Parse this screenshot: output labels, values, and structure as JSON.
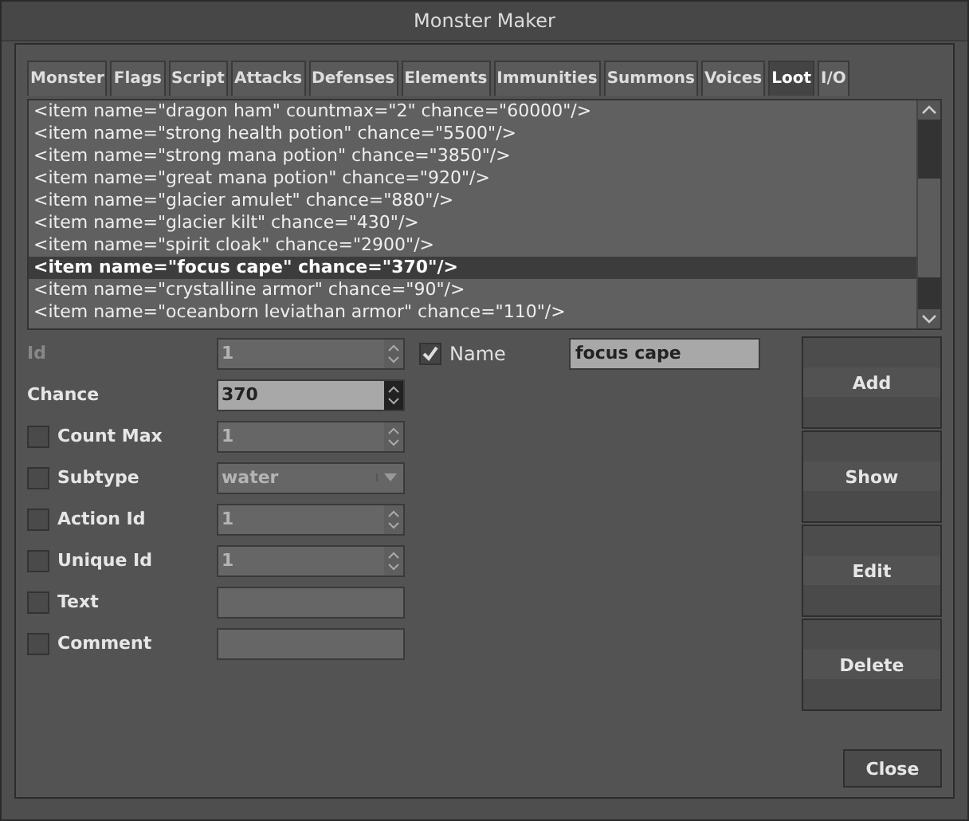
{
  "window": {
    "title": "Monster Maker"
  },
  "tabs": [
    {
      "label": "Monster",
      "selected": false
    },
    {
      "label": "Flags",
      "selected": false
    },
    {
      "label": "Script",
      "selected": false
    },
    {
      "label": "Attacks",
      "selected": false
    },
    {
      "label": "Defenses",
      "selected": false
    },
    {
      "label": "Elements",
      "selected": false
    },
    {
      "label": "Immunities",
      "selected": false
    },
    {
      "label": "Summons",
      "selected": false
    },
    {
      "label": "Voices",
      "selected": false
    },
    {
      "label": "Loot",
      "selected": true
    },
    {
      "label": "I/O",
      "selected": false
    }
  ],
  "loot_list": [
    {
      "text": "<item name=\"dragon ham\" countmax=\"2\" chance=\"60000\"/>",
      "selected": false
    },
    {
      "text": "<item name=\"strong health potion\" chance=\"5500\"/>",
      "selected": false
    },
    {
      "text": "<item name=\"strong mana potion\" chance=\"3850\"/>",
      "selected": false
    },
    {
      "text": "<item name=\"great mana potion\" chance=\"920\"/>",
      "selected": false
    },
    {
      "text": "<item name=\"glacier amulet\" chance=\"880\"/>",
      "selected": false
    },
    {
      "text": "<item name=\"glacier kilt\" chance=\"430\"/>",
      "selected": false
    },
    {
      "text": "<item name=\"spirit cloak\" chance=\"2900\"/>",
      "selected": false
    },
    {
      "text": "<item name=\"focus cape\" chance=\"370\"/>",
      "selected": true
    },
    {
      "text": "<item name=\"crystalline armor\" chance=\"90\"/>",
      "selected": false
    },
    {
      "text": "<item name=\"oceanborn leviathan armor\" chance=\"110\"/>",
      "selected": false
    }
  ],
  "fields": [
    {
      "label": "Id",
      "kind": "spin",
      "value": "1",
      "disabled": true
    },
    {
      "label": "Chance",
      "kind": "spin",
      "value": "370",
      "disabled": false
    },
    {
      "label": "Count Max",
      "kind": "spin",
      "value": "1",
      "disabled": true,
      "checked": false
    },
    {
      "label": "Subtype",
      "kind": "combo",
      "value": "water",
      "disabled": true,
      "checked": false
    },
    {
      "label": "Action Id",
      "kind": "spin",
      "value": "1",
      "disabled": true,
      "checked": false
    },
    {
      "label": "Unique Id",
      "kind": "spin",
      "value": "1",
      "disabled": true,
      "checked": false
    },
    {
      "label": "Text",
      "kind": "text",
      "disabled": true,
      "checked": false
    },
    {
      "label": "Comment",
      "kind": "text",
      "disabled": true,
      "checked": false
    }
  ],
  "name_field": {
    "label": "Name",
    "checked": true,
    "value": "focus cape"
  },
  "buttons": [
    "Add",
    "Show",
    "Edit",
    "Delete"
  ],
  "close_button": "Close"
}
